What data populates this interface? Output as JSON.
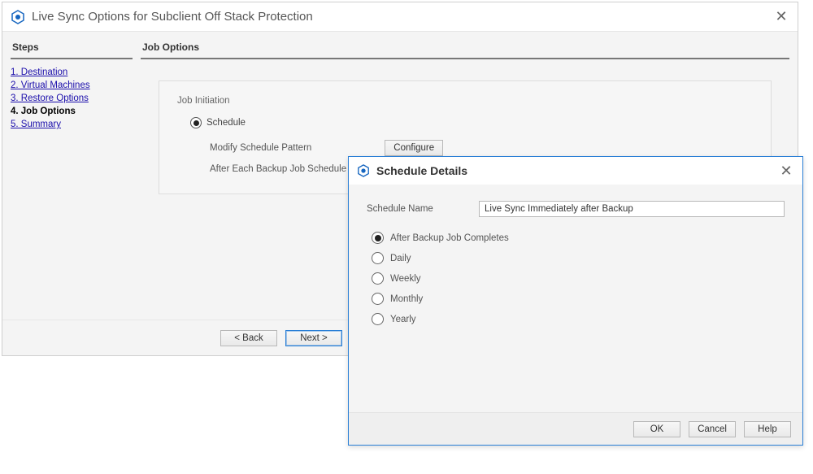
{
  "wizard": {
    "title": "Live Sync Options for Subclient Off Stack Protection",
    "steps_header": "Steps",
    "steps": [
      {
        "label": "1. Destination",
        "current": false
      },
      {
        "label": "2. Virtual Machines",
        "current": false
      },
      {
        "label": "3. Restore Options",
        "current": false
      },
      {
        "label": "4. Job Options",
        "current": true
      },
      {
        "label": "5. Summary",
        "current": false
      }
    ],
    "main_header": "Job Options",
    "job_initiation": {
      "group_label": "Job Initiation",
      "schedule_label": "Schedule",
      "modify_label": "Modify Schedule Pattern",
      "configure_label": "Configure",
      "after_each_label": "After Each Backup Job Schedule"
    },
    "buttons": {
      "back": "< Back",
      "next": "Next >"
    }
  },
  "dialog": {
    "title": "Schedule Details",
    "name_label": "Schedule Name",
    "name_value": "Live Sync Immediately after Backup",
    "options": [
      {
        "label": "After Backup Job Completes",
        "selected": true
      },
      {
        "label": "Daily",
        "selected": false
      },
      {
        "label": "Weekly",
        "selected": false
      },
      {
        "label": "Monthly",
        "selected": false
      },
      {
        "label": "Yearly",
        "selected": false
      }
    ],
    "buttons": {
      "ok": "OK",
      "cancel": "Cancel",
      "help": "Help"
    }
  }
}
